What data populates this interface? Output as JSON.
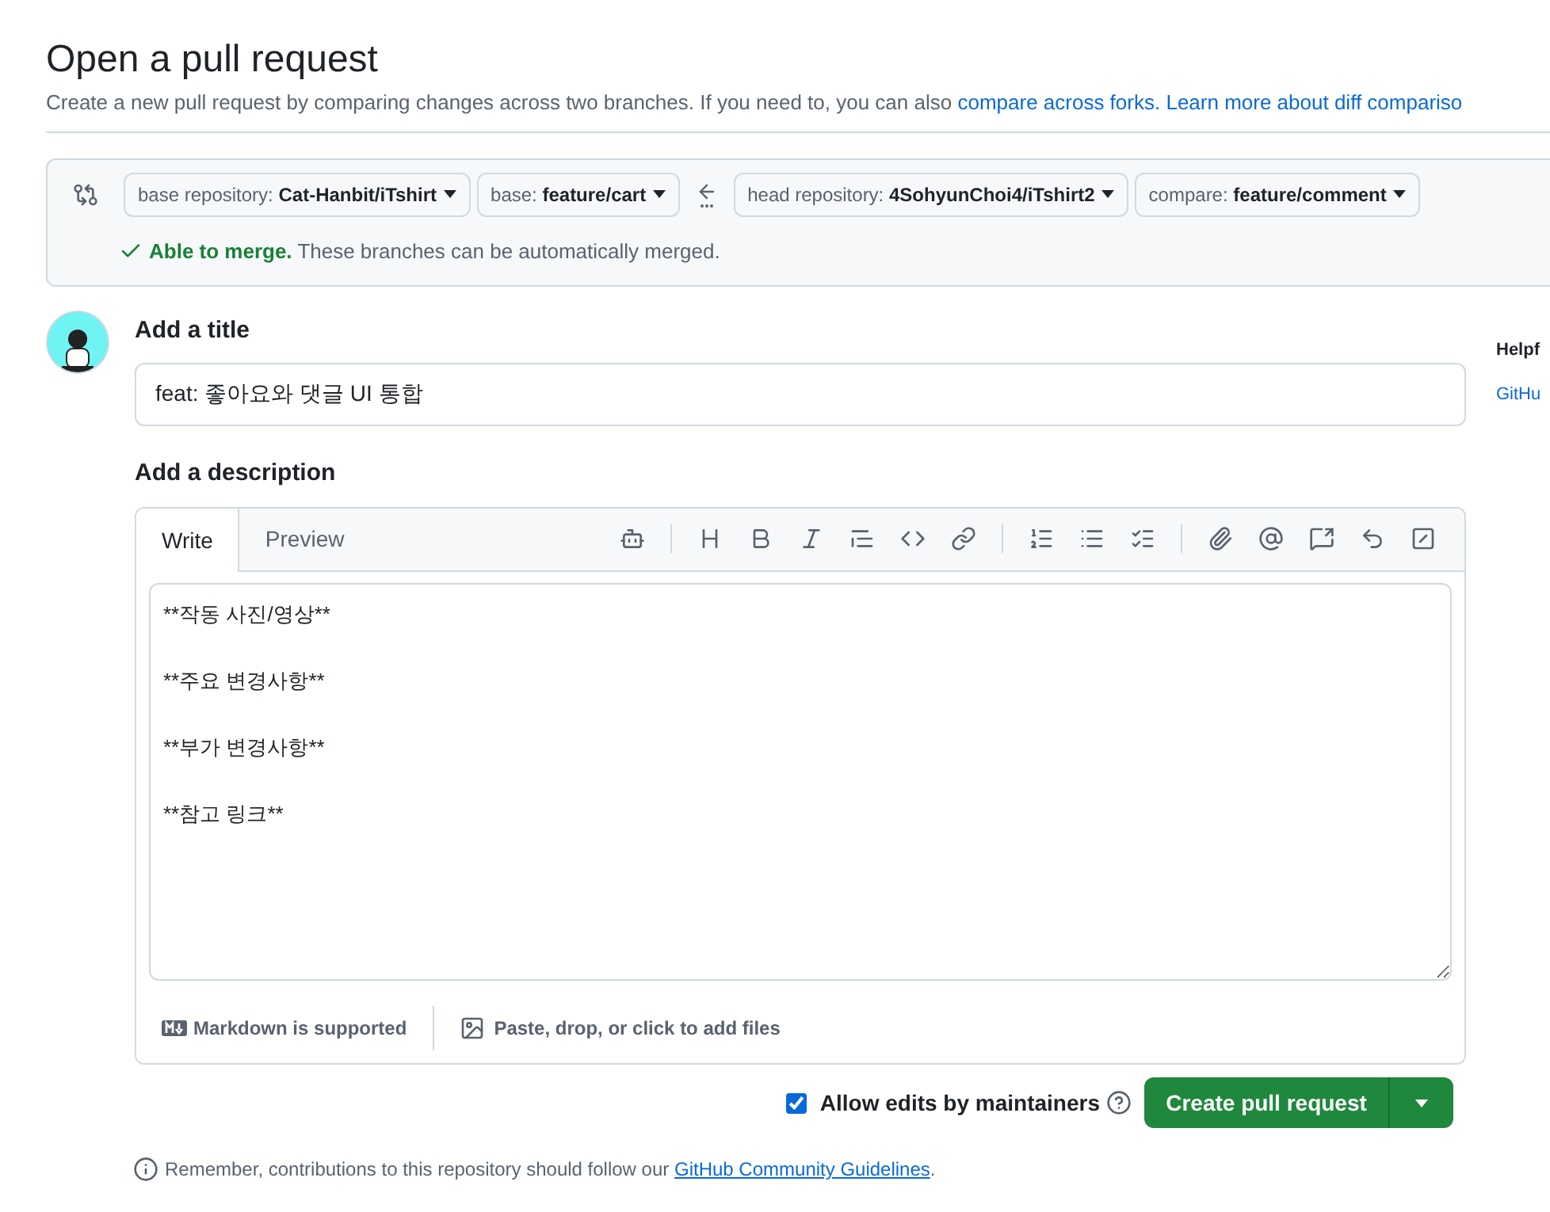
{
  "header": {
    "title": "Open a pull request",
    "subtitle": "Create a new pull request by comparing changes across two branches. If you need to, you can also ",
    "links": [
      "compare across forks.",
      "Learn more about diff compariso"
    ]
  },
  "compare": {
    "selectors": [
      {
        "label": "base repository:",
        "value": "Cat-Hanbit/iTshirt"
      },
      {
        "label": "base:",
        "value": "feature/cart"
      },
      {
        "label": "head repository:",
        "value": "4SohyunChoi4/iTshirt2"
      },
      {
        "label": "compare:",
        "value": "feature/comment"
      }
    ],
    "merge_status": {
      "title": "Able to merge.",
      "text": "These branches can be automatically merged."
    }
  },
  "form": {
    "title_label": "Add a title",
    "title_value": "feat: 좋아요와 댓글 UI 통합",
    "description_label": "Add a description",
    "tabs": [
      {
        "label": "Write",
        "selected": true
      },
      {
        "label": "Preview",
        "selected": false
      }
    ],
    "body": "**작동 사진/영상**\n\n**주요 변경사항**\n\n**부가 변경사항**\n\n**참고 링크**",
    "footer": [
      "Markdown is supported",
      "Paste, drop, or click to add files"
    ],
    "allow_edits": {
      "label": "Allow edits by maintainers",
      "checked": true
    },
    "submit": "Create pull request",
    "note": {
      "text": "Remember, contributions to this repository should follow our ",
      "link": "GitHub Community Guidelines",
      "end": "."
    }
  },
  "sidebar": {
    "heading": "Helpf",
    "link": "GitHu"
  }
}
